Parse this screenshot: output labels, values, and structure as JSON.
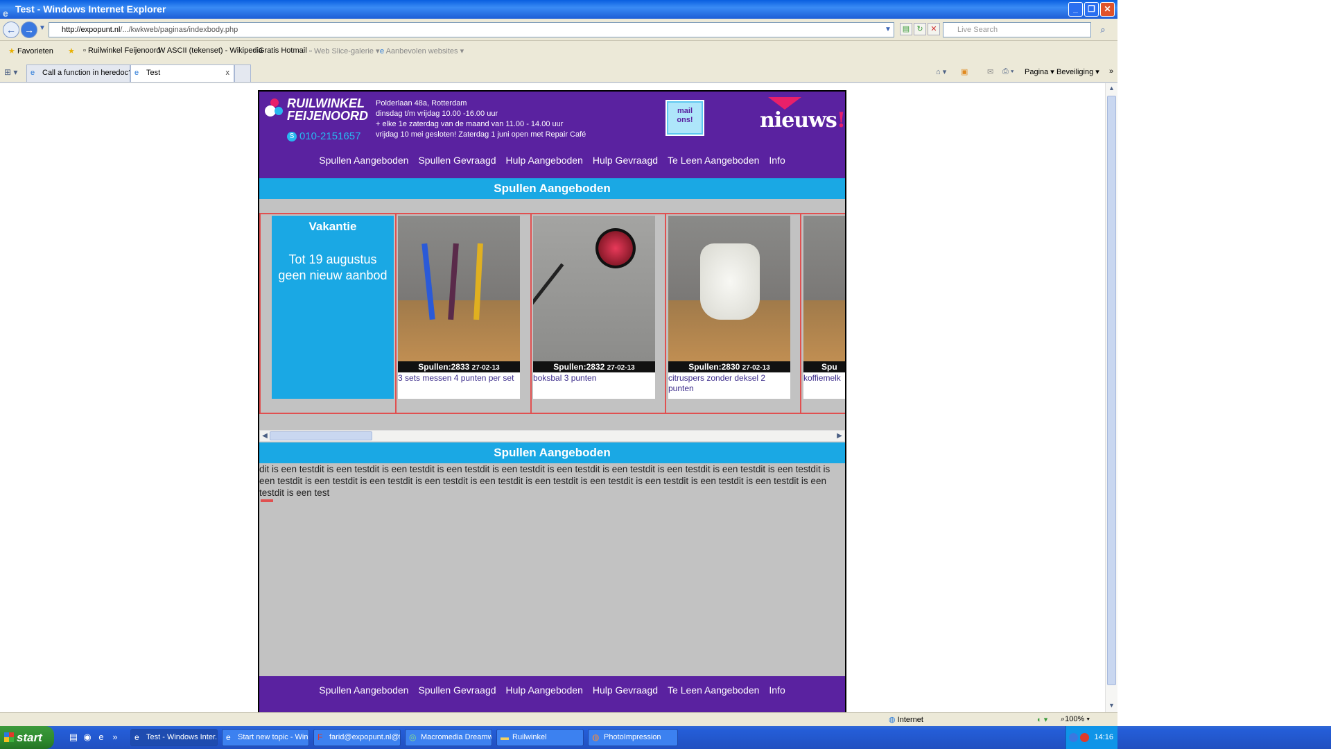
{
  "window": {
    "title": "Test - Windows Internet Explorer",
    "minimize": "_",
    "restore": "❐",
    "close": "✕"
  },
  "address_bar": {
    "url_host": "http://expopunt.nl",
    "url_path": "/.../kwkweb/paginas/indexbody.php",
    "search_placeholder": "Live Search"
  },
  "favorites": {
    "label": "Favorieten",
    "items": [
      {
        "label": "Ruilwinkel Feijenoord",
        "dim": false
      },
      {
        "label": "ASCII (tekenset) - Wikipedia",
        "dim": false
      },
      {
        "label": "Gratis Hotmail",
        "dim": false
      },
      {
        "label": "Web Slice-galerie ▾",
        "dim": true
      },
      {
        "label": "Aanbevolen websites ▾",
        "dim": true
      }
    ]
  },
  "tabs": [
    {
      "label": "Call a function in heredoc???",
      "active": false
    },
    {
      "label": "Test",
      "active": true
    }
  ],
  "command_bar": {
    "page": "Pagina ▾",
    "security": "Beveiliging ▾"
  },
  "site": {
    "logo_line1": "RUILWINKEL",
    "logo_line2": "FEIJENOORD",
    "phone": "010-2151657",
    "address_lines": [
      "Polderlaan 48a, Rotterdam",
      "dinsdag t/m vrijdag 10.00 -16.00 uur",
      "+ elke 1e zaterdag van de maand van 11.00 - 14.00 uur",
      "vrijdag 10 mei gesloten! Zaterdag 1 juni open met Repair Café"
    ],
    "mail_line1": "mail",
    "mail_line2": "ons!",
    "nieuws": "nieuws",
    "nieuws_bang": "!!",
    "nav": [
      "Spullen Aangeboden",
      "Spullen Gevraagd",
      "Hulp Aangeboden",
      "Hulp Gevraagd",
      "Te Leen Aangeboden",
      "Info"
    ],
    "section_title": "Spullen Aangeboden",
    "vacation_title": "Vakantie",
    "vacation_text": "Tot 19 augustus geen nieuw aanbod",
    "cards": [
      {
        "code": "Spullen:2833",
        "date": "27-02-13",
        "desc": "3 sets messen 4 punten per set",
        "photo": "knives-photo"
      },
      {
        "code": "Spullen:2832",
        "date": "27-02-13",
        "desc": "boksbal 3 punten",
        "photo": "punching-ball-photo"
      },
      {
        "code": "Spullen:2830",
        "date": "27-02-13",
        "desc": "citruspers zonder deksel 2 punten",
        "photo": "citrus-press-photo"
      },
      {
        "code": "Spu",
        "date": "",
        "desc": "koffiemelk",
        "photo": "partial-item-photo"
      }
    ],
    "section_title_2": "Spullen Aangeboden",
    "body_text": "dit is een testdit is een testdit is een testdit is een testdit is een testdit is een testdit is een testdit is een testdit is een testdit is een testdit is een testdit is een testdit is een testdit is een testdit is een testdit is een testdit is een testdit is een testdit is een testdit is een testdit is een testdit is een test"
  },
  "statusbar": {
    "zone": "Internet",
    "zoom": "100%"
  },
  "taskbar": {
    "start": "start",
    "tasks": [
      {
        "label": "Test - Windows Inter...",
        "active": true
      },
      {
        "label": "Start new topic - Win...",
        "active": false
      },
      {
        "label": "farid@expopunt.nl@f...",
        "active": false
      },
      {
        "label": "Macromedia Dreamw...",
        "active": false
      },
      {
        "label": "Ruilwinkel",
        "active": false
      },
      {
        "label": "PhotoImpression",
        "active": false
      }
    ],
    "clock": "14:16"
  },
  "colors": {
    "site_purple": "#5a22a0",
    "site_blue": "#1aa8e4",
    "card_border": "#e05050"
  }
}
